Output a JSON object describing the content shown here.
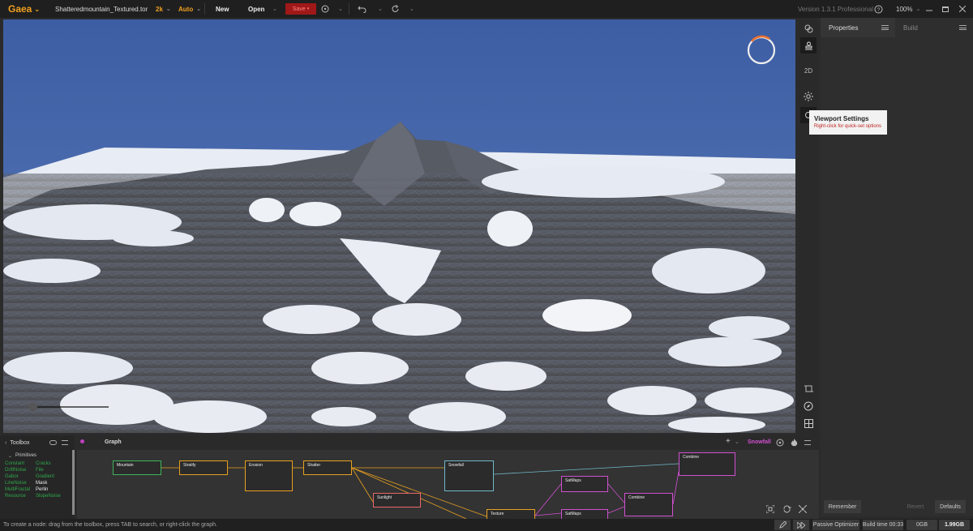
{
  "app": {
    "name": "Gaea",
    "filename": "Shatteredmountain_Textured.tor",
    "resolution": "2k",
    "build_mode": "Auto",
    "version": "Version 1.3.1 Professional",
    "zoom": "100%"
  },
  "toolbar": {
    "new_label": "New",
    "open_label": "Open",
    "save_label": "Save"
  },
  "viewport_tools": {
    "mode_2d": "2D"
  },
  "tooltip": {
    "title": "Viewport Settings",
    "hint": "Right-click for quick-set options"
  },
  "properties": {
    "tab_properties": "Properties",
    "tab_build": "Build",
    "remember_label": "Remember",
    "revert_label": "Revert",
    "defaults_label": "Defaults"
  },
  "toolbox": {
    "title": "Toolbox",
    "section": "Primitives",
    "items": [
      {
        "name": "Constant",
        "highlight": false
      },
      {
        "name": "Cracks",
        "highlight": false
      },
      {
        "name": "DriftNoise",
        "highlight": false
      },
      {
        "name": "File",
        "highlight": false
      },
      {
        "name": "Gabor",
        "highlight": false
      },
      {
        "name": "Gradient",
        "highlight": false
      },
      {
        "name": "LineNoise",
        "highlight": false
      },
      {
        "name": "Mask",
        "highlight": true
      },
      {
        "name": "MultiFractal",
        "highlight": false
      },
      {
        "name": "Perlin",
        "highlight": true
      },
      {
        "name": "Resource",
        "highlight": false
      },
      {
        "name": "SlopeNoise",
        "highlight": false
      }
    ]
  },
  "graph": {
    "tab_label": "Graph",
    "active_node": "Snowfall",
    "nodes": [
      {
        "label": "Mountain",
        "color": "#3fb45a"
      },
      {
        "label": "Stratify",
        "color": "#e8a020"
      },
      {
        "label": "Erosion",
        "color": "#e8a020"
      },
      {
        "label": "Shatter",
        "color": "#e8a020"
      },
      {
        "label": "Sunlight",
        "color": "#e86868"
      },
      {
        "label": "Snowfall",
        "color": "#6fb8c8"
      },
      {
        "label": "Texture",
        "color": "#e8a020"
      },
      {
        "label": "SatMaps",
        "color": "#d050d0"
      },
      {
        "label": "SatMaps",
        "color": "#d050d0"
      },
      {
        "label": "Combine",
        "color": "#d050d0"
      },
      {
        "label": "Combine",
        "color": "#d050d0"
      }
    ]
  },
  "status": {
    "hint": "To create a node: drag from the toolbox, press TAB to search, or right-click the graph.",
    "optimizer_label": "Passive Optimizer",
    "build_time": "Build time 00:33",
    "mem1": "0GB",
    "mem2": "1.99GB"
  },
  "colors": {
    "accent": "#f0a020",
    "save_red": "#a01818",
    "sky": "#4a6ba8",
    "toolbox_green": "#2ea84a"
  }
}
